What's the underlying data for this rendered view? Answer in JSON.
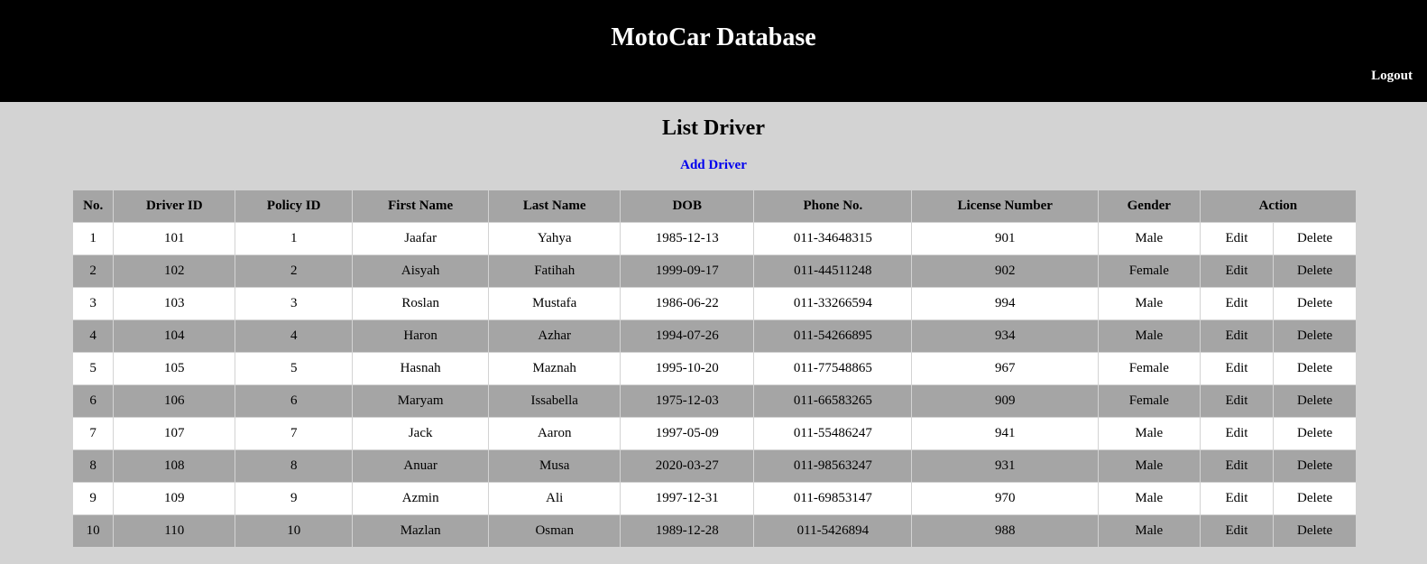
{
  "header": {
    "title": "MotoCar Database",
    "logout_label": "Logout"
  },
  "page": {
    "title": "List Driver",
    "add_label": "Add Driver"
  },
  "table": {
    "columns": [
      "No.",
      "Driver ID",
      "Policy ID",
      "First Name",
      "Last Name",
      "DOB",
      "Phone No.",
      "License Number",
      "Gender",
      "Action"
    ],
    "rows": [
      [
        "1",
        "101",
        "1",
        "Jaafar",
        "Yahya",
        "1985-12-13",
        "011-34648315",
        "901",
        "Male"
      ],
      [
        "2",
        "102",
        "2",
        "Aisyah",
        "Fatihah",
        "1999-09-17",
        "011-44511248",
        "902",
        "Female"
      ],
      [
        "3",
        "103",
        "3",
        "Roslan",
        "Mustafa",
        "1986-06-22",
        "011-33266594",
        "994",
        "Male"
      ],
      [
        "4",
        "104",
        "4",
        "Haron",
        "Azhar",
        "1994-07-26",
        "011-54266895",
        "934",
        "Male"
      ],
      [
        "5",
        "105",
        "5",
        "Hasnah",
        "Maznah",
        "1995-10-20",
        "011-77548865",
        "967",
        "Female"
      ],
      [
        "6",
        "106",
        "6",
        "Maryam",
        "Issabella",
        "1975-12-03",
        "011-66583265",
        "909",
        "Female"
      ],
      [
        "7",
        "107",
        "7",
        "Jack",
        "Aaron",
        "1997-05-09",
        "011-55486247",
        "941",
        "Male"
      ],
      [
        "8",
        "108",
        "8",
        "Anuar",
        "Musa",
        "2020-03-27",
        "011-98563247",
        "931",
        "Male"
      ],
      [
        "9",
        "109",
        "9",
        "Azmin",
        "Ali",
        "1997-12-31",
        "011-69853147",
        "970",
        "Male"
      ],
      [
        "10",
        "110",
        "10",
        "Mazlan",
        "Osman",
        "1989-12-28",
        "011-5426894",
        "988",
        "Male"
      ]
    ],
    "edit_label": "Edit",
    "delete_label": "Delete"
  }
}
